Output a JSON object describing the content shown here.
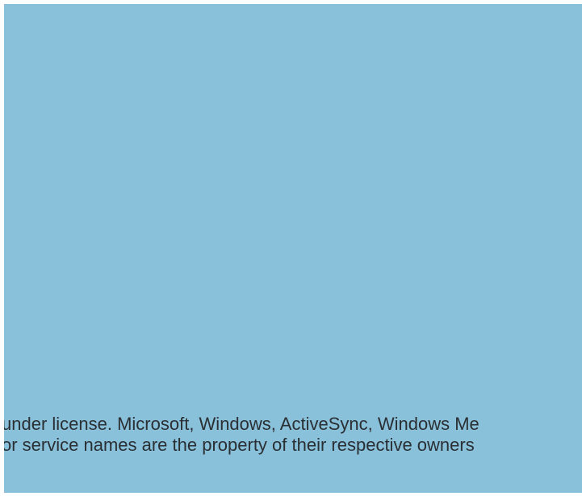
{
  "colors": {
    "background": "#8ac1da",
    "text": "#2a2f33"
  },
  "legal_notice": {
    "line1": "under license. Microsoft, Windows, ActiveSync, Windows Me",
    "line2": "or service names are the property of their respective owners"
  }
}
